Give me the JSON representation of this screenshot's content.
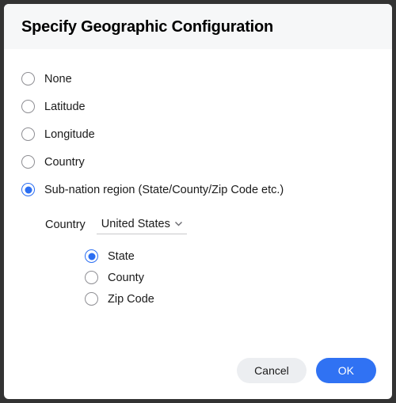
{
  "dialog": {
    "title": "Specify Geographic Configuration"
  },
  "options": {
    "none": "None",
    "latitude": "Latitude",
    "longitude": "Longitude",
    "country": "Country",
    "subnation": "Sub-nation region (State/County/Zip Code etc.)"
  },
  "sub": {
    "country_label": "Country",
    "country_value": "United States",
    "state": "State",
    "county": "County",
    "zip": "Zip Code"
  },
  "footer": {
    "cancel": "Cancel",
    "ok": "OK"
  }
}
